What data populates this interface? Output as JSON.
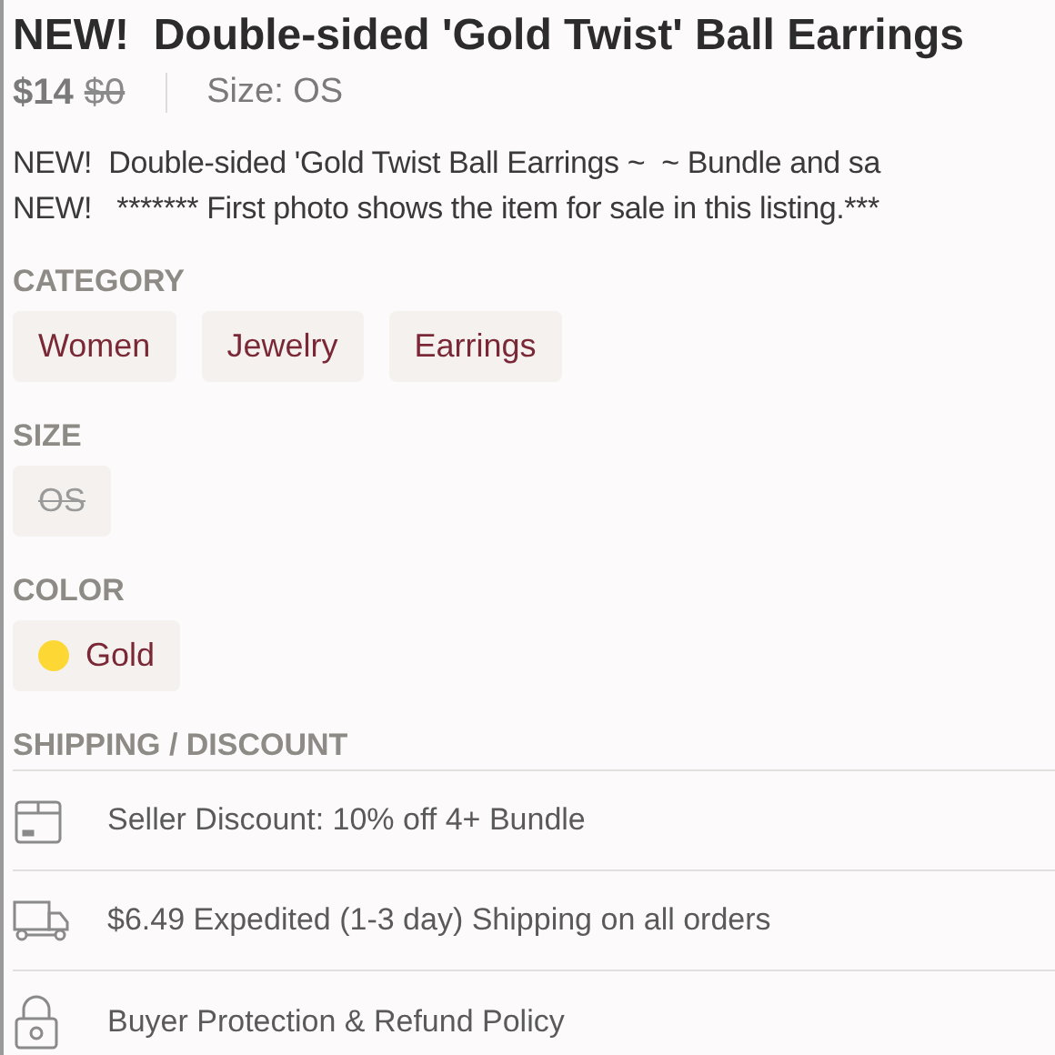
{
  "title": "NEW!  Double-sided 'Gold Twist' Ball Earrings",
  "price": {
    "current": "$14",
    "original": "$0"
  },
  "size_label": "Size: OS",
  "description": [
    "NEW!  Double-sided 'Gold Twist Ball Earrings ~  ~ Bundle and sa",
    "NEW!   ******* First photo shows the item for sale in this listing.***"
  ],
  "category": {
    "heading": "CATEGORY",
    "tags": [
      "Women",
      "Jewelry",
      "Earrings"
    ]
  },
  "size": {
    "heading": "SIZE",
    "options": [
      {
        "label": "OS",
        "unavailable": true
      }
    ]
  },
  "color": {
    "heading": "COLOR",
    "options": [
      {
        "label": "Gold",
        "color": "#fdd835"
      }
    ]
  },
  "shipping": {
    "heading": "SHIPPING / DISCOUNT",
    "rows": [
      {
        "kind": "box",
        "text": "Seller Discount: 10% off 4+ Bundle"
      },
      {
        "kind": "truck",
        "text": "$6.49 Expedited (1-3 day) Shipping on all orders"
      },
      {
        "kind": "lock",
        "text": "Buyer Protection & Refund Policy"
      }
    ]
  }
}
